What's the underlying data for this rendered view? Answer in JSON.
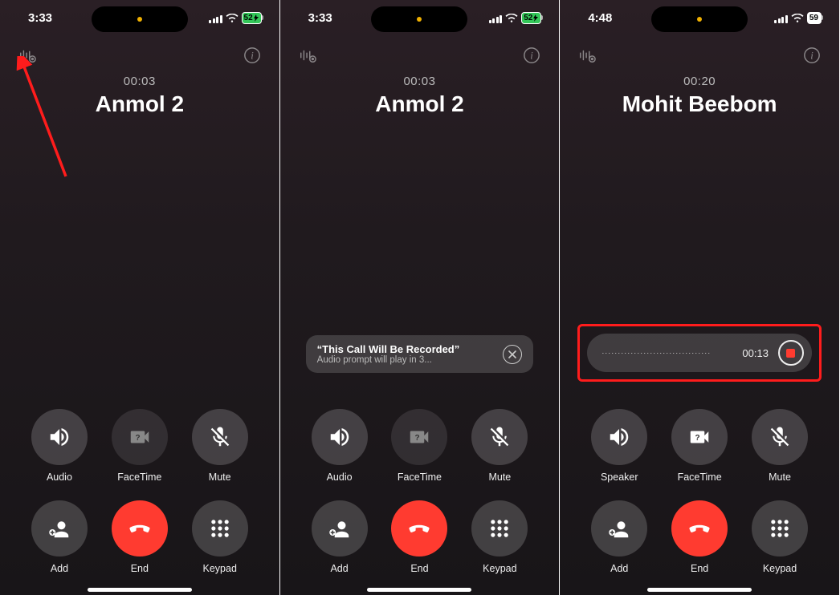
{
  "screens": [
    {
      "status": {
        "time": "3:33",
        "battery": "52",
        "charging": true
      },
      "timer": "00:03",
      "contact": "Anmol 2",
      "buttons": [
        {
          "label": "Audio",
          "icon": "speaker-icon"
        },
        {
          "label": "FaceTime",
          "icon": "facetime-icon"
        },
        {
          "label": "Mute",
          "icon": "mute-icon"
        },
        {
          "label": "Add",
          "icon": "add-icon"
        },
        {
          "label": "End",
          "icon": "end-icon"
        },
        {
          "label": "Keypad",
          "icon": "keypad-icon"
        }
      ],
      "annotation": "arrow-to-record"
    },
    {
      "status": {
        "time": "3:33",
        "battery": "52",
        "charging": true
      },
      "timer": "00:03",
      "contact": "Anmol 2",
      "buttons": [
        {
          "label": "Audio",
          "icon": "speaker-icon"
        },
        {
          "label": "FaceTime",
          "icon": "facetime-icon"
        },
        {
          "label": "Mute",
          "icon": "mute-icon"
        },
        {
          "label": "Add",
          "icon": "add-icon"
        },
        {
          "label": "End",
          "icon": "end-icon"
        },
        {
          "label": "Keypad",
          "icon": "keypad-icon"
        }
      ],
      "notification": {
        "title": "“This Call Will Be Recorded”",
        "subtitle": "Audio prompt will play in 3..."
      }
    },
    {
      "status": {
        "time": "4:48",
        "battery": "59",
        "charging": false
      },
      "timer": "00:20",
      "contact": "Mohit Beebom",
      "buttons": [
        {
          "label": "Speaker",
          "icon": "speaker-icon"
        },
        {
          "label": "FaceTime",
          "icon": "facetime-icon"
        },
        {
          "label": "Mute",
          "icon": "mute-icon"
        },
        {
          "label": "Add",
          "icon": "add-icon"
        },
        {
          "label": "End",
          "icon": "end-icon"
        },
        {
          "label": "Keypad",
          "icon": "keypad-icon"
        }
      ],
      "recording": {
        "time": "00:13",
        "waveform": "··································"
      }
    }
  ]
}
